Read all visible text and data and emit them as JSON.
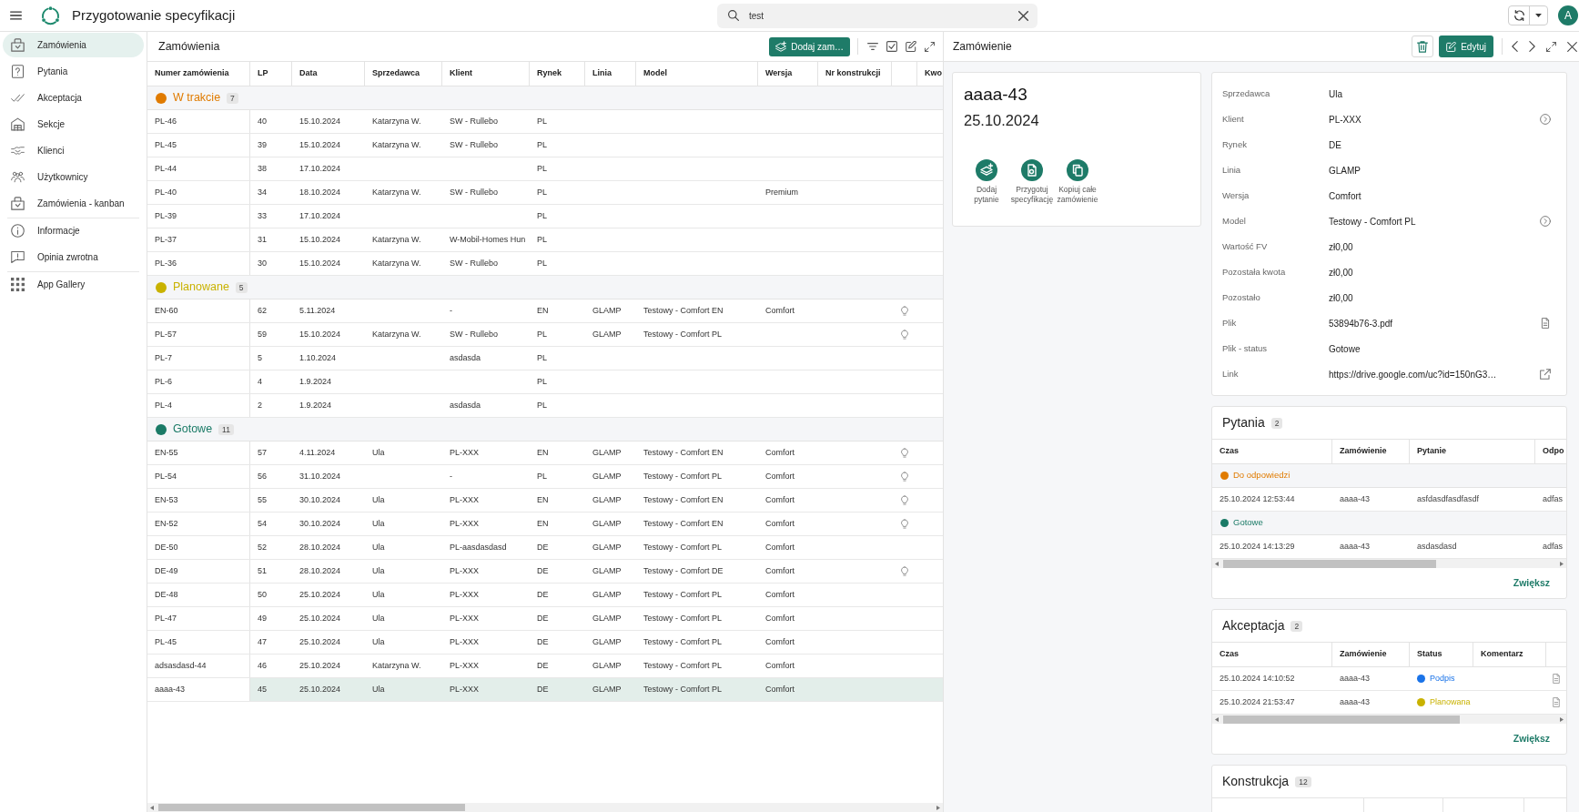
{
  "app_bar": {
    "title": "Przygotowanie specyfikacji",
    "search": {
      "value": "test"
    },
    "avatar": "A"
  },
  "sidebar": {
    "groups": [
      {
        "items": [
          {
            "label": "Zamówienia",
            "selected": true
          },
          {
            "label": "Pytania",
            "selected": false
          },
          {
            "label": "Akceptacja",
            "selected": false
          },
          {
            "label": "Sekcje",
            "selected": false
          },
          {
            "label": "Klienci",
            "selected": false
          },
          {
            "label": "Użytkownicy",
            "selected": false
          },
          {
            "label": "Zamówienia - kanban",
            "selected": false
          }
        ]
      },
      {
        "items": [
          {
            "label": "Informacje",
            "selected": false
          },
          {
            "label": "Opinia zwrotna",
            "selected": false
          }
        ]
      },
      {
        "items": [
          {
            "label": "App Gallery",
            "selected": false
          }
        ]
      }
    ]
  },
  "orders": {
    "title": "Zamówienia",
    "add_button": "Dodaj zam…",
    "table": {
      "columns": [
        "Numer zamówienia",
        "LP",
        "Data",
        "Sprzedawca",
        "Klient",
        "Rynek",
        "Linia",
        "Model",
        "Wersja",
        "Nr konstrukcji",
        "Kwo"
      ],
      "groups": [
        {
          "label": "W trakcie",
          "count": "7",
          "color": "#e07b00",
          "rows": [
            {
              "number": "PL-46",
              "lp": "40",
              "date": "15.10.2024",
              "seller": "Katarzyna W.",
              "client": "SW - Rullebo",
              "market": "PL",
              "lightbulb": false,
              "selected": false
            },
            {
              "number": "PL-45",
              "lp": "39",
              "date": "15.10.2024",
              "seller": "Katarzyna W.",
              "client": "SW - Rullebo",
              "market": "PL",
              "lightbulb": false,
              "selected": false
            },
            {
              "number": "PL-44",
              "lp": "38",
              "date": "17.10.2024",
              "market": "PL",
              "lightbulb": false,
              "selected": false
            },
            {
              "number": "PL-40",
              "lp": "34",
              "date": "18.10.2024",
              "seller": "Katarzyna W.",
              "client": "SW - Rullebo",
              "market": "PL",
              "version": "Premium",
              "lightbulb": false,
              "selected": false
            },
            {
              "number": "PL-39",
              "lp": "33",
              "date": "17.10.2024",
              "market": "PL",
              "lightbulb": false,
              "selected": false
            },
            {
              "number": "PL-37",
              "lp": "31",
              "date": "15.10.2024",
              "seller": "Katarzyna W.",
              "client": "W-Mobil-Homes Hun",
              "market": "PL",
              "lightbulb": false,
              "selected": false
            },
            {
              "number": "PL-36",
              "lp": "30",
              "date": "15.10.2024",
              "seller": "Katarzyna W.",
              "client": "SW - Rullebo",
              "market": "PL",
              "lightbulb": false,
              "selected": false
            }
          ]
        },
        {
          "label": "Planowane",
          "count": "5",
          "color": "#c9b200",
          "rows": [
            {
              "number": "EN-60",
              "lp": "62",
              "date": "5.11.2024",
              "client": "-",
              "market": "EN",
              "line": "GLAMP",
              "model": "Testowy - Comfort EN",
              "version": "Comfort",
              "lightbulb": true,
              "selected": false
            },
            {
              "number": "PL-57",
              "lp": "59",
              "date": "15.10.2024",
              "seller": "Katarzyna W.",
              "client": "SW - Rullebo",
              "market": "PL",
              "line": "GLAMP",
              "model": "Testowy - Comfort PL",
              "lightbulb": true,
              "selected": false
            },
            {
              "number": "PL-7",
              "lp": "5",
              "date": "1.10.2024",
              "client": "asdasda",
              "market": "PL",
              "lightbulb": false,
              "selected": false
            },
            {
              "number": "PL-6",
              "lp": "4",
              "date": "1.9.2024",
              "market": "PL",
              "lightbulb": false,
              "selected": false
            },
            {
              "number": "PL-4",
              "lp": "2",
              "date": "1.9.2024",
              "client": "asdasda",
              "market": "PL",
              "lightbulb": false,
              "selected": false
            }
          ]
        },
        {
          "label": "Gotowe",
          "count": "11",
          "color": "#1a7a66",
          "rows": [
            {
              "number": "EN-55",
              "lp": "57",
              "date": "4.11.2024",
              "seller": "Ula",
              "client": "PL-XXX",
              "market": "EN",
              "line": "GLAMP",
              "model": "Testowy - Comfort EN",
              "version": "Comfort",
              "lightbulb": true,
              "selected": false
            },
            {
              "number": "PL-54",
              "lp": "56",
              "date": "31.10.2024",
              "client": "-",
              "market": "PL",
              "line": "GLAMP",
              "model": "Testowy - Comfort PL",
              "version": "Comfort",
              "lightbulb": true,
              "selected": false
            },
            {
              "number": "EN-53",
              "lp": "55",
              "date": "30.10.2024",
              "seller": "Ula",
              "client": "PL-XXX",
              "market": "EN",
              "line": "GLAMP",
              "model": "Testowy - Comfort EN",
              "version": "Comfort",
              "lightbulb": true,
              "selected": false
            },
            {
              "number": "EN-52",
              "lp": "54",
              "date": "30.10.2024",
              "seller": "Ula",
              "client": "PL-XXX",
              "market": "EN",
              "line": "GLAMP",
              "model": "Testowy - Comfort EN",
              "version": "Comfort",
              "lightbulb": true,
              "selected": false
            },
            {
              "number": "DE-50",
              "lp": "52",
              "date": "28.10.2024",
              "seller": "Ula",
              "client": "PL-aasdasdasd",
              "market": "DE",
              "line": "GLAMP",
              "model": "Testowy - Comfort PL",
              "version": "Comfort",
              "lightbulb": false,
              "selected": false
            },
            {
              "number": "DE-49",
              "lp": "51",
              "date": "28.10.2024",
              "seller": "Ula",
              "client": "PL-XXX",
              "market": "DE",
              "line": "GLAMP",
              "model": "Testowy - Comfort DE",
              "version": "Comfort",
              "lightbulb": true,
              "selected": false
            },
            {
              "number": "DE-48",
              "lp": "50",
              "date": "25.10.2024",
              "seller": "Ula",
              "client": "PL-XXX",
              "market": "DE",
              "line": "GLAMP",
              "model": "Testowy - Comfort PL",
              "version": "Comfort",
              "lightbulb": false,
              "selected": false
            },
            {
              "number": "PL-47",
              "lp": "49",
              "date": "25.10.2024",
              "seller": "Ula",
              "client": "PL-XXX",
              "market": "DE",
              "line": "GLAMP",
              "model": "Testowy - Comfort PL",
              "version": "Comfort",
              "lightbulb": false,
              "selected": false
            },
            {
              "number": "PL-45",
              "lp": "47",
              "date": "25.10.2024",
              "seller": "Ula",
              "client": "PL-XXX",
              "market": "DE",
              "line": "GLAMP",
              "model": "Testowy - Comfort PL",
              "version": "Comfort",
              "lightbulb": false,
              "selected": false
            },
            {
              "number": "adsasdasd-44",
              "lp": "46",
              "date": "25.10.2024",
              "seller": "Katarzyna W.",
              "client": "PL-XXX",
              "market": "DE",
              "line": "GLAMP",
              "model": "Testowy - Comfort PL",
              "version": "Comfort",
              "lightbulb": false,
              "selected": false
            },
            {
              "number": "aaaa-43",
              "lp": "45",
              "date": "25.10.2024",
              "seller": "Ula",
              "client": "PL-XXX",
              "market": "DE",
              "line": "GLAMP",
              "model": "Testowy - Comfort PL",
              "version": "Comfort",
              "lightbulb": false,
              "selected": true
            }
          ]
        }
      ]
    }
  },
  "order_detail": {
    "title": "Zamówienie",
    "edit_button": "Edytuj",
    "summary": {
      "number": "aaaa-43",
      "date": "25.10.2024",
      "actions": [
        "Dodaj pytanie",
        "Przygotuj specyfikację",
        "Kopiuj całe zamówienie"
      ]
    },
    "fields": [
      {
        "label": "Sprzedawca",
        "value": "Ula",
        "kind": "text"
      },
      {
        "label": "Klient",
        "value": "PL-XXX",
        "kind": "navigate"
      },
      {
        "label": "Rynek",
        "value": "DE",
        "kind": "text"
      },
      {
        "label": "Linia",
        "value": "GLAMP",
        "kind": "text"
      },
      {
        "label": "Wersja",
        "value": "Comfort",
        "kind": "text"
      },
      {
        "label": "Model",
        "value": "Testowy - Comfort PL",
        "kind": "navigate"
      },
      {
        "label": "Wartość FV",
        "value": "zł0,00",
        "kind": "text"
      },
      {
        "label": "Pozostała kwota",
        "value": "zł0,00",
        "kind": "text"
      },
      {
        "label": "Pozostało",
        "value": "zł0,00",
        "kind": "text"
      },
      {
        "label": "Plik",
        "value": "53894b76-3.pdf",
        "kind": "file"
      },
      {
        "label": "Plik - status",
        "value": "Gotowe",
        "kind": "text"
      },
      {
        "label": "Link",
        "value": "https://drive.google.com/uc?id=150nG3…",
        "kind": "external"
      }
    ],
    "questions": {
      "title": "Pytania",
      "count": "2",
      "columns": [
        "Czas",
        "Zamówienie",
        "Pytanie",
        "Odpo"
      ],
      "groups": [
        {
          "label": "Do odpowiedzi",
          "color": "#e07b00",
          "rows": [
            {
              "time": "25.10.2024 12:53:44",
              "order": "aaaa-43",
              "question": "asfdasdfasdfasdf",
              "answer": "adfas"
            }
          ]
        },
        {
          "label": "Gotowe",
          "color": "#1a7a66",
          "rows": [
            {
              "time": "25.10.2024 14:13:29",
              "order": "aaaa-43",
              "question": "asdasdasd",
              "answer": "adfas"
            }
          ]
        }
      ],
      "more_link": "Zwiększ"
    },
    "acceptance": {
      "title": "Akceptacja",
      "count": "2",
      "columns": [
        "Czas",
        "Zamówienie",
        "Status",
        "Komentarz"
      ],
      "rows": [
        {
          "time": "25.10.2024 14:10:52",
          "order": "aaaa-43",
          "status": "Podpis",
          "color": "#1a73e8"
        },
        {
          "time": "25.10.2024 21:53:47",
          "order": "aaaa-43",
          "status": "Planowana",
          "color": "#c9b200"
        }
      ],
      "more_link": "Zwiększ"
    },
    "construction": {
      "title": "Konstrukcja",
      "count": "12"
    }
  }
}
